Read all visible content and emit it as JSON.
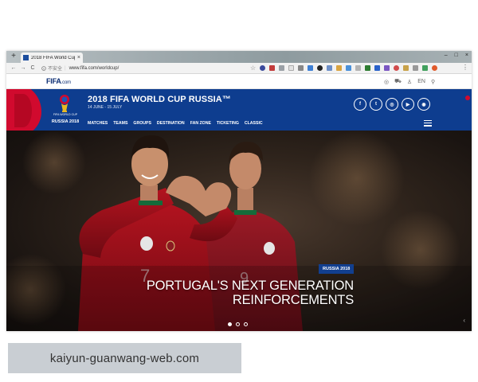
{
  "browser": {
    "tab_title": "2018 FIFA World Cup R",
    "tab_close": "×",
    "new_tab": "+",
    "window_controls": [
      "–",
      "□",
      "×"
    ],
    "nav": {
      "back": "←",
      "forward": "→",
      "reload": "C"
    },
    "security_label": "不安全",
    "url": "www.fifa.com/worldcup/"
  },
  "fifa_bar": {
    "logo_main": "FIFA",
    "logo_suffix": ".com",
    "lang": "EN"
  },
  "header": {
    "emblem_text": "FIFA WORLD CUP",
    "emblem_sub": "RUSSIA 2018",
    "title": "2018 FIFA WORLD CUP RUSSIA™",
    "dates": "14 JUNE - 15 JULY",
    "nav": [
      "MATCHES",
      "TEAMS",
      "GROUPS",
      "DESTINATION",
      "FAN ZONE",
      "TICKETING",
      "CLASSIC"
    ],
    "social": [
      "f",
      "t",
      "◎",
      "▶",
      "◉"
    ]
  },
  "hero": {
    "tag": "RUSSIA 2018",
    "headline_line1": "PORTUGAL'S NEXT GENERATION",
    "headline_line2": "REINFORCEMENTS",
    "player1_number": "7",
    "player2_number": "9"
  },
  "watermark": "kaiyun-guanwang-web.com",
  "colors": {
    "fifa_blue": "#0e3d8f",
    "wc_red": "#d10a2e",
    "portugal_red": "#a3121e"
  }
}
